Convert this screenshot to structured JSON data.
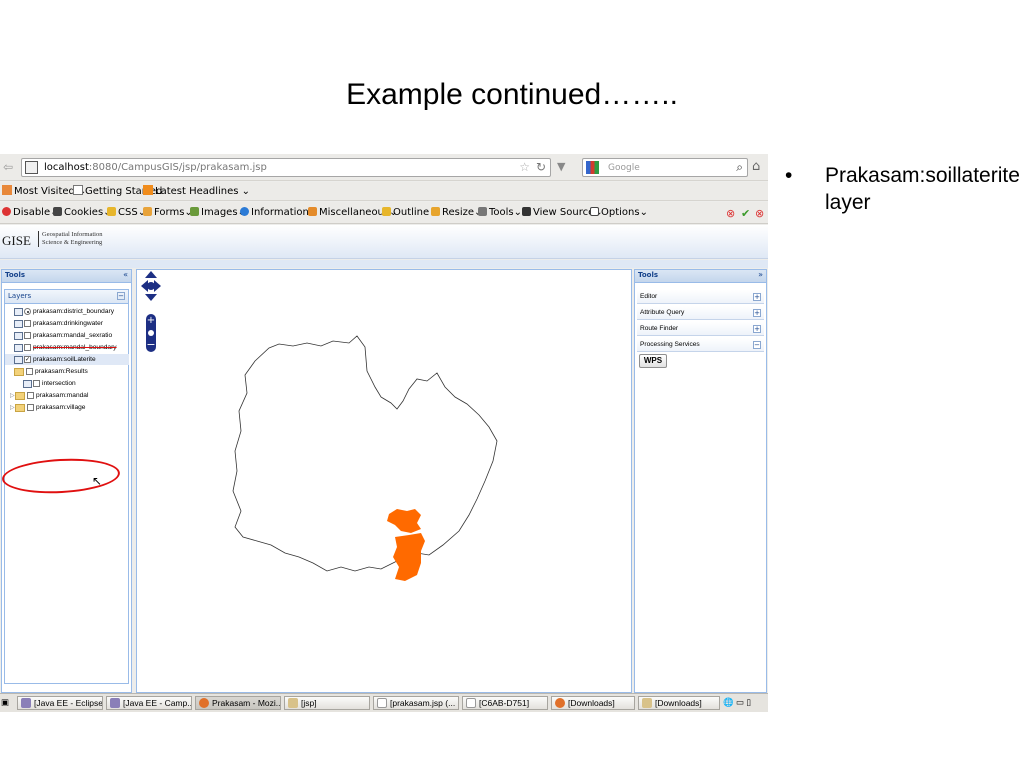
{
  "slide": {
    "title": "Example continued……..",
    "bullet": "Prakasam:soillaterite layer",
    "bullet_marker": "•"
  },
  "browser": {
    "url_host": "localhost",
    "url_rest": ":8080/CampusGIS/jsp/prakasam.jsp",
    "search_placeholder": "Google",
    "bookmarks": [
      "Most Visited",
      "Getting Started",
      "Latest Headlines"
    ],
    "webdev_menu": [
      "Disable",
      "Cookies",
      "CSS",
      "Forms",
      "Images",
      "Information",
      "Miscellaneous",
      "Outline",
      "Resize",
      "Tools",
      "View Source",
      "Options"
    ]
  },
  "app": {
    "logo": "GISE",
    "logo_sub_1": "Geospatial Information",
    "logo_sub_2": "Science & Engineering",
    "left_panel_title": "Tools",
    "left_collapse": "«",
    "layers_title": "Layers",
    "layers_collapse": "−",
    "layers": [
      {
        "label": "prakasam:district_boundary",
        "control": "radio"
      },
      {
        "label": "prakasam:drinkingwater",
        "control": "checkbox"
      },
      {
        "label": "prakasam:mandal_sexratio",
        "control": "checkbox"
      },
      {
        "label": "prakasam:mandal_boundary",
        "control": "checkbox"
      },
      {
        "label": "prakasam:soilLaterite",
        "control": "checkbox-checked"
      },
      {
        "label": "prakasam:Results",
        "control": "folder"
      },
      {
        "label": "intersection",
        "control": "checkbox"
      },
      {
        "label": "prakasam:mandal",
        "control": "folder"
      },
      {
        "label": "prakasam:village",
        "control": "folder"
      }
    ],
    "right_panel_title": "Tools",
    "right_expand": "»",
    "tools": [
      {
        "label": "Editor",
        "toggle": "+"
      },
      {
        "label": "Attribute Query",
        "toggle": "+"
      },
      {
        "label": "Route Finder",
        "toggle": "+"
      },
      {
        "label": "Processing Services",
        "toggle": "−"
      }
    ],
    "wps_button": "WPS",
    "highlight_color": "#ff6a00"
  },
  "taskbar": [
    {
      "label": "[Java EE - Eclipse ]",
      "active": false
    },
    {
      "label": "[Java EE - Camp...",
      "active": false
    },
    {
      "label": "Prakasam - Mozi...",
      "active": true
    },
    {
      "label": "[jsp]",
      "active": false
    },
    {
      "label": "[prakasam.jsp (...",
      "active": false
    },
    {
      "label": "[C6AB-D751]",
      "active": false
    },
    {
      "label": "[Downloads]",
      "active": false
    },
    {
      "label": "[Downloads]",
      "active": false
    }
  ]
}
